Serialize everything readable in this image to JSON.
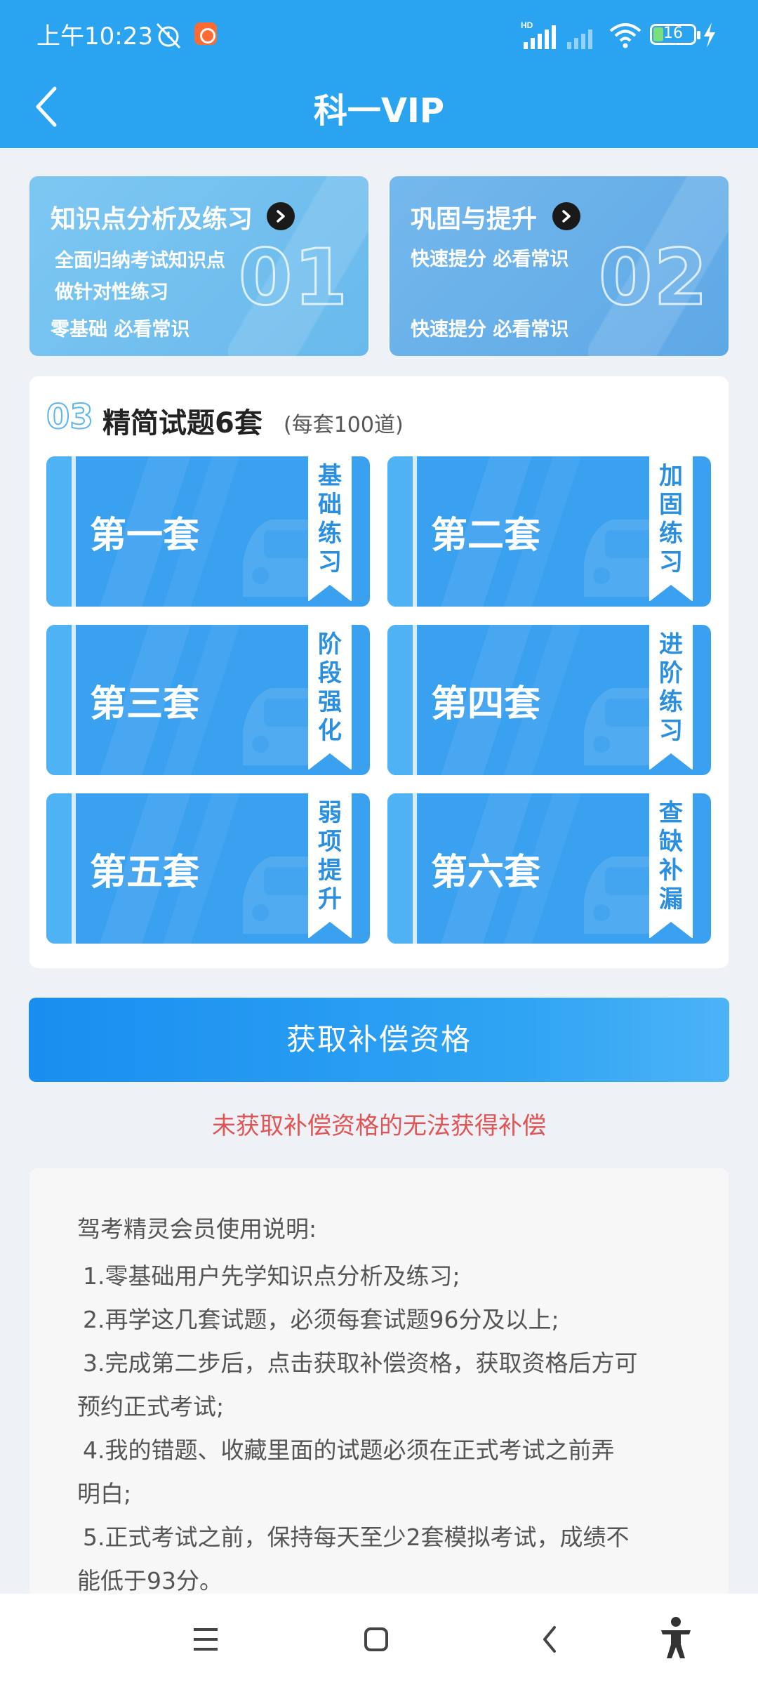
{
  "status_bar": {
    "time": "上午10:23",
    "battery": "16",
    "icons": [
      "alarm-off-icon",
      "app-notification-icon",
      "hd-signal-icon",
      "signal-icon",
      "wifi-icon",
      "battery-icon",
      "charging-icon"
    ]
  },
  "header": {
    "title": "科一VIP",
    "back_icon": "chevron-left-icon"
  },
  "cards": [
    {
      "title": "知识点分析及练习",
      "lines": [
        "全面归纳考试知识点",
        "做针对性练习",
        "零基础 必看常识"
      ],
      "number": "01"
    },
    {
      "title": "巩固与提升",
      "lines": [
        "快速提分 必看常识",
        "快速提分 必看常识"
      ],
      "number": "02"
    }
  ],
  "section": {
    "number": "03",
    "title": "精简试题6套",
    "subtitle": "(每套100道)",
    "sets": [
      {
        "name": "第一套",
        "tag": "基础练习"
      },
      {
        "name": "第二套",
        "tag": "加固练习"
      },
      {
        "name": "第三套",
        "tag": "阶段强化"
      },
      {
        "name": "第四套",
        "tag": "进阶练习"
      },
      {
        "name": "第五套",
        "tag": "弱项提升"
      },
      {
        "name": "第六套",
        "tag": "查缺补漏"
      }
    ]
  },
  "cta": {
    "label": "获取补偿资格"
  },
  "warning": "未获取补偿资格的无法获得补偿",
  "instructions": {
    "heading": "驾考精灵会员使用说明:",
    "items": [
      "1.零基础用户先学知识点分析及练习;",
      "2.再学这几套试题，必须每套试题96分及以上;",
      "3.完成第二步后，点击获取补偿资格，获取资格后方可",
      "预约正式考试;",
      "4.我的错题、收藏里面的试题必须在正式考试之前弄",
      "明白;",
      "5.正式考试之前，保持每天至少2套模拟考试，成绩不",
      "能低于93分。"
    ]
  },
  "navbar": {
    "icons": [
      "menu-icon",
      "home-icon",
      "back-icon",
      "accessibility-icon"
    ]
  },
  "colors": {
    "primary": "#2aa3f0",
    "warning": "#e05555",
    "tile": "#3aa0f0"
  }
}
